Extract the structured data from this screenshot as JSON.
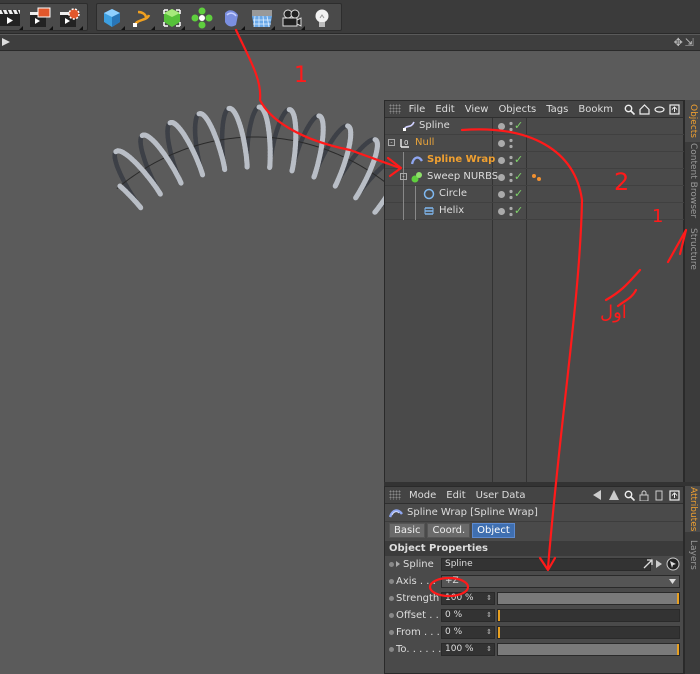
{
  "toolbar": {
    "buttons": [
      {
        "name": "render-view-icon"
      },
      {
        "name": "render-picture-viewer-icon"
      },
      {
        "name": "render-settings-icon"
      },
      {
        "name": "cube-icon"
      },
      {
        "name": "spline-pen-icon"
      },
      {
        "name": "nurbs-icon"
      },
      {
        "name": "array-icon"
      },
      {
        "name": "deformer-icon"
      },
      {
        "name": "floor-icon"
      },
      {
        "name": "camera-icon"
      },
      {
        "name": "light-icon"
      }
    ]
  },
  "object_manager": {
    "menu": [
      "File",
      "Edit",
      "View",
      "Objects",
      "Tags",
      "Bookm"
    ],
    "objects": [
      {
        "label": "Spline",
        "depth": 0,
        "color": "#dddddd",
        "icon": "spline-icon",
        "check": true
      },
      {
        "label": "Null",
        "depth": 0,
        "color": "#e8a33a",
        "icon": "null-icon",
        "check": false
      },
      {
        "label": "Spline Wrap",
        "depth": 1,
        "color": "#f0a030",
        "icon": "spline-wrap-icon",
        "check": true
      },
      {
        "label": "Sweep NURBS",
        "depth": 1,
        "color": "#dddddd",
        "icon": "sweep-nurbs-icon",
        "check": true
      },
      {
        "label": "Circle",
        "depth": 2,
        "color": "#dddddd",
        "icon": "circle-icon",
        "check": true
      },
      {
        "label": "Helix",
        "depth": 2,
        "color": "#dddddd",
        "icon": "helix-icon",
        "check": true
      }
    ],
    "side_tabs": [
      "Objects",
      "Content Browser",
      "Structure"
    ]
  },
  "attributes": {
    "menu": [
      "Mode",
      "Edit",
      "User Data"
    ],
    "title": "Spline Wrap [Spline Wrap]",
    "tabs": [
      {
        "label": "Basic",
        "active": false
      },
      {
        "label": "Coord.",
        "active": false
      },
      {
        "label": "Object",
        "active": true
      }
    ],
    "section": "Object Properties",
    "spline": {
      "label": "Spline",
      "value": "Spline"
    },
    "axis": {
      "label": "Axis . . .",
      "value": "+Z"
    },
    "strength": {
      "label": "Strength",
      "value": "100 %",
      "fraction": 1.0
    },
    "offset": {
      "label": "Offset . .",
      "value": "0 %",
      "fraction": 0.0
    },
    "from": {
      "label": "From . . .",
      "value": "0 %",
      "fraction": 0.0
    },
    "to": {
      "label": "To. . . . . .",
      "value": "100 %",
      "fraction": 1.0
    },
    "side_tabs": [
      "Attributes",
      "Layers"
    ]
  },
  "annotations": {
    "numbers": [
      "1",
      "2",
      "1"
    ],
    "note": "اول",
    "color": "#ff1a1a"
  }
}
